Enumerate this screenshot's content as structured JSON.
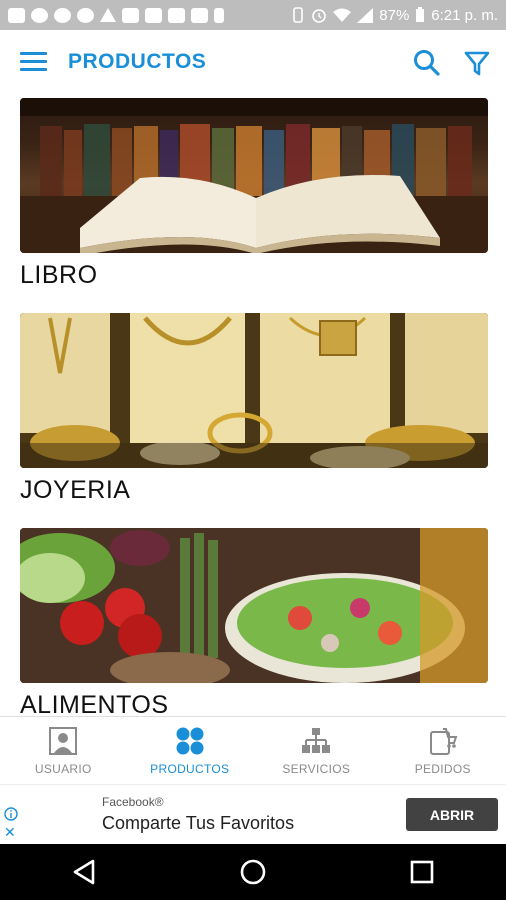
{
  "status_bar": {
    "battery": "87%",
    "time": "6:21 p. m."
  },
  "header": {
    "title": "PRODUCTOS",
    "accent_color": "#1a8fd8",
    "menu_icon": "hamburger-menu-icon",
    "search_icon": "search-icon",
    "filter_icon": "filter-icon"
  },
  "categories": [
    {
      "label": "LIBRO",
      "image": "open-book-on-bookshelf"
    },
    {
      "label": "JOYERIA",
      "image": "gold-jewelry-display"
    },
    {
      "label": "ALIMENTOS",
      "image": "vegetables-and-salad"
    }
  ],
  "bottom_nav": {
    "items": [
      {
        "label": "USUARIO",
        "icon": "user-icon",
        "active": false
      },
      {
        "label": "PRODUCTOS",
        "icon": "grid-dots-icon",
        "active": true
      },
      {
        "label": "SERVICIOS",
        "icon": "hierarchy-icon",
        "active": false
      },
      {
        "label": "PEDIDOS",
        "icon": "cart-icon",
        "active": false
      }
    ]
  },
  "ad": {
    "brand": "Facebook®",
    "text": "Comparte Tus Favoritos",
    "button_label": "ABRIR"
  }
}
